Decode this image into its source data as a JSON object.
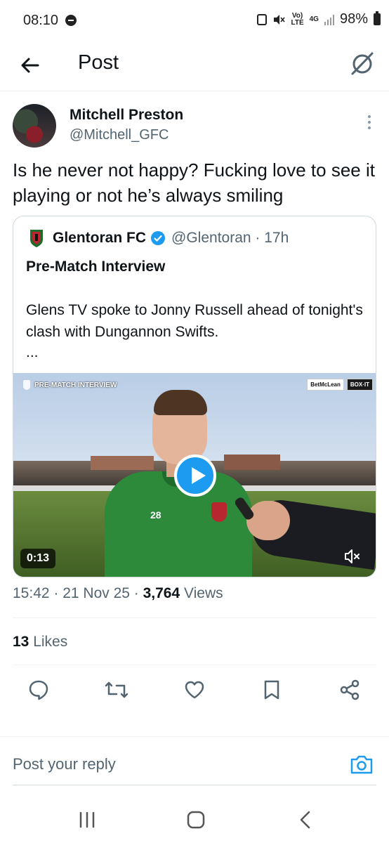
{
  "status_bar": {
    "time": "08:10",
    "volte": "Vo)",
    "lte_label": "LTE",
    "net": "4G",
    "battery": "98%"
  },
  "header": {
    "title": "Post"
  },
  "post": {
    "author_name": "Mitchell Preston",
    "author_handle": "@Mitchell_GFC",
    "text": "Is he never not happy? Fucking love to see it playing or not he’s always smiling",
    "timestamp": "15:42 · 21 Nov 25 · ",
    "views_count": "3,764",
    "views_label": " Views",
    "likes_count": "13",
    "likes_label": " Likes"
  },
  "quote": {
    "name": "Glentoran FC",
    "handle": "@Glentoran · 17h",
    "title": "Pre-Match Interview",
    "body": "Glens TV spoke to Jonny Russell ahead of tonight's  clash with Dungannon Swifts.",
    "ellipsis": "...",
    "video": {
      "overlay_label": "PRE-MATCH INTERVIEW",
      "sponsor_1": "BetMcLean",
      "sponsor_2": "BOX·IT",
      "jersey_number": "28",
      "duration": "0:13"
    }
  },
  "reply": {
    "placeholder": "Post your reply"
  },
  "colors": {
    "accent": "#1d9bf0",
    "text": "#0f1419",
    "secondary": "#536471"
  },
  "icons": [
    "back-arrow-icon",
    "grok-icon",
    "more-icon",
    "verified-icon",
    "play-icon",
    "mute-icon",
    "reply-icon",
    "repost-icon",
    "like-icon",
    "bookmark-icon",
    "share-icon",
    "camera-icon",
    "recent-apps-icon",
    "home-icon",
    "back-nav-icon"
  ]
}
